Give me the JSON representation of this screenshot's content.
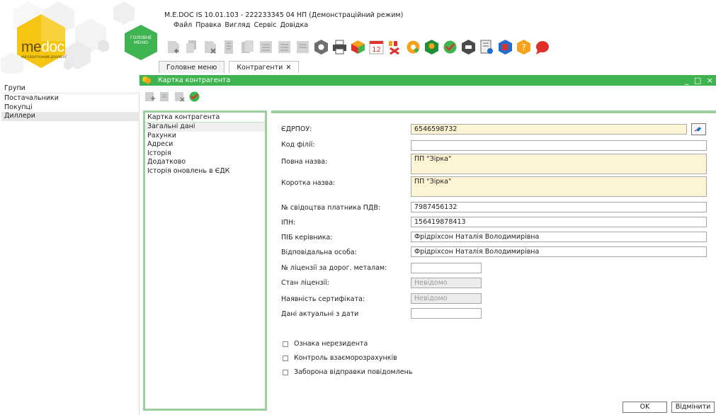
{
  "app": {
    "window_title": "M.E.DOC IS 10.01.103 - 222233345 04 НП (Демонстраційний режим)",
    "logo_me": "me",
    "logo_doc": "doc",
    "logo_sub": "МІЙ ЕЛЕКТРОННИЙ ДОКУМЕНТ",
    "home_label": "ГОЛОВНЕ МЕНЮ",
    "brand_color": "#f4c20d",
    "accent_green": "#3fb34f"
  },
  "menu": [
    "Файл",
    "Правка",
    "Вигляд",
    "Сервіс",
    "Довідка"
  ],
  "toolbar_icons": [
    "create-document-icon",
    "copy-document-icon",
    "delete-document-icon",
    "document-icon",
    "documents-icon",
    "list-icon",
    "list-icon",
    "list-icon",
    "shield-icon",
    "printer-icon",
    "box-icon",
    "calendar-icon",
    "reports-icon",
    "gear-icon",
    "refresh-icon",
    "check-icon",
    "shield-icon",
    "settings-icon",
    "help-book-icon",
    "help-icon",
    "chat-icon"
  ],
  "calendar_day": "12",
  "tabs": [
    {
      "label": "Головне меню",
      "closable": false,
      "active": false
    },
    {
      "label": "Контрагенти",
      "closable": true,
      "active": true
    }
  ],
  "groups": {
    "title": "Групи",
    "items": [
      "Постачальники",
      "Покупці",
      "Диллери"
    ],
    "selected": "Диллери"
  },
  "card": {
    "window_title": "Картка контрагента",
    "window_controls": "_ □ ×",
    "nav_title": "Картка контрагента",
    "nav_items": [
      "Загальні дані",
      "Рахунки",
      "Адреси",
      "Історія",
      "Додатково",
      "Історія оновлень в ЄДК"
    ],
    "nav_selected": "Загальні дані"
  },
  "form": {
    "edrpou_label": "ЄДРПОУ:",
    "edrpou": "6546598732",
    "branch_code_label": "Код філії:",
    "branch_code": "",
    "full_name_label": "Повна назва:",
    "full_name": "ПП \"Зірка\"",
    "short_name_label": "Коротка назва:",
    "short_name": "ПП \"Зірка\"",
    "vat_cert_label": "№ свідоцтва платника ПДВ:",
    "vat_cert": "7987456132",
    "ipn_label": "ІПН:",
    "ipn": "156419878413",
    "director_label": "ПІБ керівника:",
    "director": "Фрідріхсон Наталія Володимирівна",
    "responsible_label": "Відповідальна особа:",
    "responsible": "Фрідріхсон Наталія Володимирівна",
    "license_label": "№ ліцензії за дорог. металам:",
    "license": "",
    "license_state_label": "Стан ліцензії:",
    "license_state": "Невідомо",
    "certificate_label": "Наявність сертифіката:",
    "certificate": "Невідомо",
    "date_label": "Дані актуальні з дати",
    "date": "",
    "checkboxes": [
      {
        "label": "Ознака нерезидента",
        "checked": false
      },
      {
        "label": "Контроль взаєморозрахунків",
        "checked": false
      },
      {
        "label": "Заборона відправки повідомлень",
        "checked": false
      }
    ]
  },
  "buttons": {
    "ok": "OK",
    "cancel": "Відмінити"
  }
}
